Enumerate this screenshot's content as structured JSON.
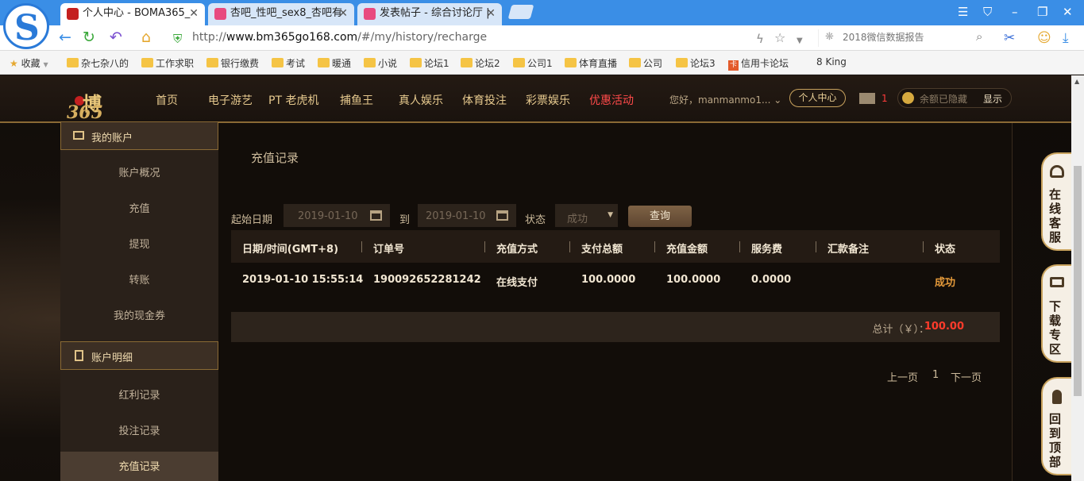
{
  "browser": {
    "tabs": [
      {
        "label": "个人中心 - BOMA365_",
        "close": "✕",
        "favicon_color": "#c42020",
        "active": true
      },
      {
        "label": "杏吧_性吧_sex8_杏吧有",
        "close": "✕",
        "favicon_color": "#e84a7f",
        "active": false
      },
      {
        "label": "发表帖子 - 综合讨论厅 |",
        "close": "✕",
        "favicon_color": "#e84a7f",
        "active": false
      }
    ],
    "logo_letter": "S",
    "url_prefix": "http://",
    "url_host": "www.bm365go168.com",
    "url_path": "/#/my/history/recharge",
    "search_placeholder": "2018微信数据报告",
    "window_controls": [
      "☰",
      "⛉",
      "–",
      "❐",
      "✕"
    ],
    "nav_icons": [
      "back-icon",
      "refresh-icon",
      "undo-icon",
      "home-icon"
    ],
    "bookmarks": [
      {
        "label": "收藏",
        "type": "star"
      },
      {
        "label": "杂七杂八的",
        "type": "folder"
      },
      {
        "label": "工作求职",
        "type": "folder"
      },
      {
        "label": "银行缴费",
        "type": "folder"
      },
      {
        "label": "考试",
        "type": "folder"
      },
      {
        "label": "暖通",
        "type": "folder"
      },
      {
        "label": "小说",
        "type": "folder"
      },
      {
        "label": "论坛1",
        "type": "folder"
      },
      {
        "label": "论坛2",
        "type": "folder"
      },
      {
        "label": "公司1",
        "type": "folder"
      },
      {
        "label": "体育直播",
        "type": "folder"
      },
      {
        "label": "公司",
        "type": "folder"
      },
      {
        "label": "论坛3",
        "type": "folder"
      },
      {
        "label": "信用卡论坛",
        "type": "card"
      },
      {
        "label": "8 King",
        "type": "text"
      }
    ]
  },
  "site": {
    "logo": {
      "top": "博",
      "bottom": "365"
    },
    "nav": [
      "首页",
      "电子游艺",
      "PT 老虎机",
      "捕鱼王",
      "真人娱乐",
      "体育投注",
      "彩票娱乐",
      "优惠活动"
    ],
    "greeting": "您好，manmanmo1...",
    "greeting_caret": "⌄",
    "center_button": "个人中心",
    "mail_count": "1",
    "balance_text": "余额已隐藏",
    "balance_show": "显示",
    "hot_color": "#ff4a4a",
    "accent_color": "#c9a35e"
  },
  "sidebar": {
    "section1": "我的账户",
    "section1_items": [
      "账户概况",
      "充值",
      "提现",
      "转账",
      "我的现金券"
    ],
    "section2": "账户明细",
    "section2_items": [
      "红利记录",
      "投注记录",
      "充值记录"
    ],
    "active_item": "充值记录"
  },
  "panel": {
    "title": "充值记录",
    "filter": {
      "start_label": "起始日期",
      "start_date": "2019-01-10",
      "to_label": "到",
      "end_date": "2019-01-10",
      "status_label": "状态",
      "status_value": "成功",
      "query_button": "查询"
    },
    "table": {
      "headers": [
        "日期/时间(GMT+8)",
        "订单号",
        "充值方式",
        "支付总额",
        "充值金额",
        "服务费",
        "汇款备注",
        "状态"
      ],
      "rows": [
        [
          "2019-01-10 15:55:14",
          "190092652281242",
          "在线支付",
          "100.0000",
          "100.0000",
          "0.0000",
          "",
          "成功"
        ]
      ]
    },
    "total_label": "总计（￥）：",
    "total_value": "100.00",
    "pager": {
      "prev": "上一页",
      "page": "1",
      "next": "下一页"
    }
  },
  "floating": [
    {
      "label": "在线客服",
      "icon": "headset-icon"
    },
    {
      "label": "下载专区",
      "icon": "monitor-icon"
    },
    {
      "label": "回到顶部",
      "icon": "rocket-icon"
    }
  ]
}
